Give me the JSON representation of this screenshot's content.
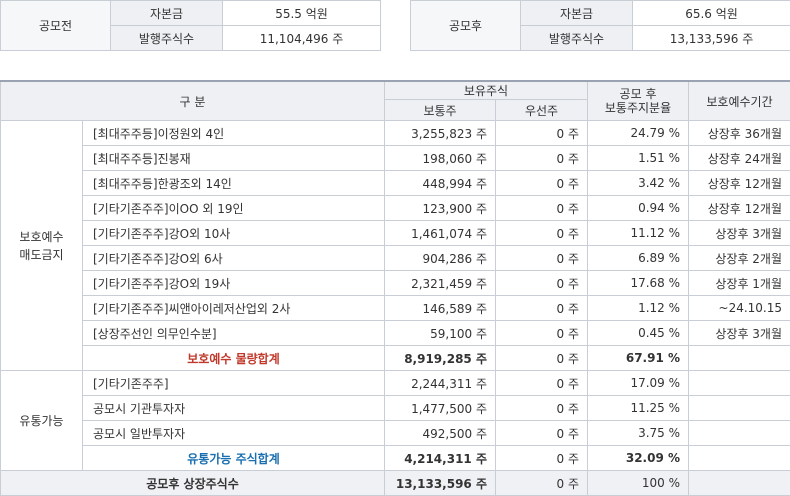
{
  "before": {
    "label": "공모전",
    "rows": [
      {
        "label": "자본금",
        "value": "55.5 억원"
      },
      {
        "label": "발행주식수",
        "value": "11,104,496 주"
      }
    ]
  },
  "after": {
    "label": "공모후",
    "rows": [
      {
        "label": "자본금",
        "value": "65.6 억원"
      },
      {
        "label": "발행주식수",
        "value": "13,133,596 주"
      }
    ]
  },
  "table": {
    "header": {
      "category": "구 분",
      "holdings": "보유주식",
      "common": "보통주",
      "preferred": "우선주",
      "ratio": "공모 후\n보통주지분율",
      "lockup": "보호예수기간"
    },
    "group1": {
      "label": "보호예수\n매도금지",
      "rows": [
        {
          "name": "[최대주주등]이정원외 4인",
          "common": "3,255,823 주",
          "preferred": "0 주",
          "ratio": "24.79 %",
          "lockup": "상장후 36개월"
        },
        {
          "name": "[최대주주등]진봉재",
          "common": "198,060 주",
          "preferred": "0 주",
          "ratio": "1.51 %",
          "lockup": "상장후 24개월"
        },
        {
          "name": "[최대주주등]한광조외 14인",
          "common": "448,994 주",
          "preferred": "0 주",
          "ratio": "3.42 %",
          "lockup": "상장후 12개월"
        },
        {
          "name": "[기타기존주주]이OO 외 19인",
          "common": "123,900 주",
          "preferred": "0 주",
          "ratio": "0.94 %",
          "lockup": "상장후 12개월"
        },
        {
          "name": "[기타기존주주]강O외 10사",
          "common": "1,461,074 주",
          "preferred": "0 주",
          "ratio": "11.12 %",
          "lockup": "상장후 3개월"
        },
        {
          "name": "[기타기존주주]강O외 6사",
          "common": "904,286 주",
          "preferred": "0 주",
          "ratio": "6.89 %",
          "lockup": "상장후 2개월"
        },
        {
          "name": "[기타기존주주]강O외 19사",
          "common": "2,321,459 주",
          "preferred": "0 주",
          "ratio": "17.68 %",
          "lockup": "상장후 1개월"
        },
        {
          "name": "[기타기존주주]씨앤아이레저산업외 2사",
          "common": "146,589 주",
          "preferred": "0 주",
          "ratio": "1.12 %",
          "lockup": "~24.10.15"
        },
        {
          "name": "[상장주선인 의무인수분]",
          "common": "59,100 주",
          "preferred": "0 주",
          "ratio": "0.45 %",
          "lockup": "상장후 3개월"
        }
      ],
      "subtotal": {
        "name": "보호예수 물량합계",
        "common": "8,919,285 주",
        "preferred": "0 주",
        "ratio": "67.91 %"
      }
    },
    "group2": {
      "label": "유통가능",
      "rows": [
        {
          "name": "[기타기존주주]",
          "common": "2,244,311 주",
          "preferred": "0 주",
          "ratio": "17.09 %"
        },
        {
          "name": "공모시 기관투자자",
          "common": "1,477,500 주",
          "preferred": "0 주",
          "ratio": "11.25 %"
        },
        {
          "name": "공모시 일반투자자",
          "common": "492,500 주",
          "preferred": "0 주",
          "ratio": "3.75 %"
        }
      ],
      "subtotal": {
        "name": "유통가능 주식합계",
        "common": "4,214,311 주",
        "preferred": "0 주",
        "ratio": "32.09 %"
      }
    },
    "total": {
      "name": "공모후 상장주식수",
      "common": "13,133,596 주",
      "preferred": "0 주",
      "ratio": "100 %"
    }
  }
}
